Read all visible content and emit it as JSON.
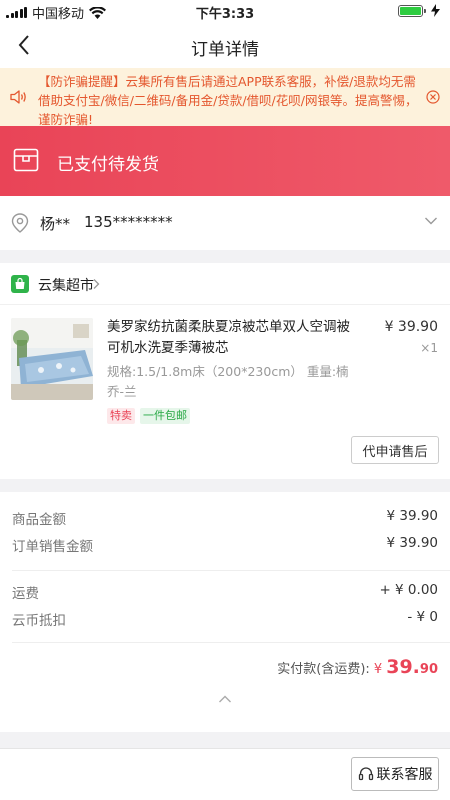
{
  "status_bar": {
    "carrier": "中国移动",
    "time": "下午3:33",
    "icons": [
      "signal-icon",
      "wifi-icon",
      "battery-icon",
      "charging-icon"
    ]
  },
  "nav": {
    "title": "订单详情",
    "back_icon": "back-arrow-icon"
  },
  "notice": {
    "text": "【防诈骗提醒】云集所有售后请通过APP联系客服，补偿/退款均无需借助支付宝/微信/二维码/备用金/贷款/借呗/花呗/网银等。提高警惕，谨防诈骗!",
    "icon": "speaker-icon",
    "close_icon": "close-circle-icon"
  },
  "order_status": {
    "label": "已支付待发货",
    "icon": "package-icon"
  },
  "address": {
    "name": "杨**",
    "phone": "135********",
    "icon": "location-pin-icon"
  },
  "store": {
    "name": "云集超市",
    "icon": "store-bag-icon",
    "product": {
      "title": "美罗家纺抗菌柔肤夏凉被芯单双人空调被可机水洗夏季薄被芯",
      "price": "¥ 39.90",
      "quantity": "×1",
      "spec": "规格:1.5/1.8m床（200*230cm） 重量:楠乔-兰",
      "tags": [
        "特卖",
        "一件包邮"
      ]
    },
    "after_sale_button": "代申请售后"
  },
  "summary": {
    "goods_amount_label": "商品金额",
    "goods_amount": "¥ 39.90",
    "order_sale_label": "订单销售金额",
    "order_sale_amount": "¥ 39.90",
    "shipping_label": "运费",
    "shipping": "+ ¥ 0.00",
    "coin_label": "云币抵扣",
    "coin": "- ¥ 0",
    "total_label": "实付款(含运费):",
    "total_currency": "¥",
    "total_integer": "39.",
    "total_decimal": "90"
  },
  "footer": {
    "service_button": "联系客服",
    "service_icon": "headset-icon"
  },
  "colors": {
    "accent": "#e94457",
    "notice_bg": "#fdf2dc",
    "notice_text": "#e4572e",
    "tag_green": "#27a844"
  }
}
